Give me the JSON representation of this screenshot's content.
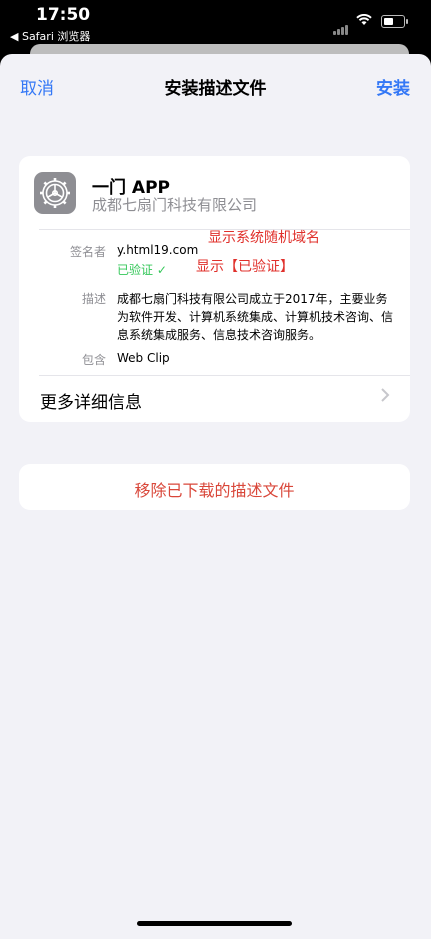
{
  "status": {
    "time": "17:50",
    "back_app": "◀ Safari 浏览器"
  },
  "nav": {
    "cancel": "取消",
    "title": "安装描述文件",
    "install": "安装"
  },
  "profile": {
    "name": "一门 APP",
    "organization": "成都七扇门科技有限公司",
    "signer_label": "签名者",
    "signer_value": "y.html19.com",
    "verified": "已验证 ✓",
    "description_label": "描述",
    "description_value": "成都七扇门科技有限公司成立于2017年，主要业务为软件开发、计算机系统集成、计算机技术咨询、信息系统集成服务、信息技术咨询服务。",
    "contains_label": "包含",
    "contains_value": "Web Clip",
    "more_details": "更多详细信息"
  },
  "annotations": {
    "random_domain": "显示系统随机域名",
    "verified_note": "显示【已验证】"
  },
  "remove_button": "移除已下载的描述文件",
  "icons": [
    "signal-icon",
    "wifi-icon",
    "battery-icon",
    "settings-gear-icon",
    "chevron-right-icon"
  ],
  "colors": {
    "accent": "#3478f6",
    "verified": "#34c759",
    "destructive": "#d9473a",
    "annotation": "#e0302b"
  }
}
